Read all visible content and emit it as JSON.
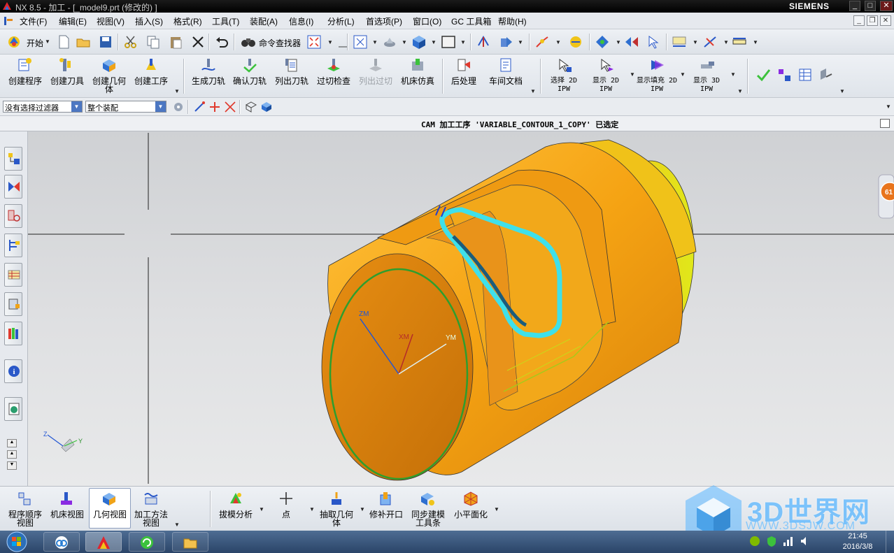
{
  "window": {
    "title": "NX 8.5 - 加工 - [_model9.prt  (修改的) ]",
    "brand": "SIEMENS",
    "buttons": [
      "_",
      "□",
      "✕"
    ]
  },
  "menu": {
    "items": [
      "文件(F)",
      "编辑(E)",
      "视图(V)",
      "插入(S)",
      "格式(R)",
      "工具(T)",
      "装配(A)",
      "信息(I)",
      "分析(L)",
      "首选项(P)",
      "窗口(O)",
      "GC 工具箱",
      "帮助(H)"
    ]
  },
  "toolbar_standard": {
    "start_label": "开始",
    "command_finder_label": "命令查找器"
  },
  "toolbar_operations": {
    "buttons": [
      "创建程序",
      "创建刀具",
      "创建几何体",
      "创建工序",
      "生成刀轨",
      "确认刀轨",
      "列出刀轨",
      "过切检查",
      "列出过切",
      "机床仿真",
      "后处理",
      "车间文档",
      "选择 2D IPW",
      "显示 2D IPW",
      "显示填充 2D IPW",
      "显示 3D IPW"
    ]
  },
  "selection_bar": {
    "filter_value": "没有选择过滤器",
    "scope_value": "整个装配"
  },
  "status": {
    "message": "CAM 加工工序 'VARIABLE_CONTOUR_1_COPY' 已选定"
  },
  "viewport": {
    "axis_labels": {
      "zm": "ZM",
      "xm": "XM",
      "ym": "YM",
      "triad_z": "Z",
      "triad_y": "Y"
    },
    "badge": "61",
    "colors": {
      "part": "#f0a318",
      "toolpath": "#3fe0ea",
      "toolpath_dark": "#1b5c7c",
      "csys": "#2e9e2e"
    }
  },
  "bottom_toolbar": {
    "views": [
      "程序顺序视图",
      "机床视图",
      "几何视图",
      "加工方法视图"
    ],
    "active_view": "几何视图",
    "tools": [
      "拔模分析",
      "点",
      "抽取几何体",
      "修补开口",
      "同步建模工具条",
      "小平面化"
    ]
  },
  "watermark": {
    "text": "3D世界网",
    "url": "WWW.3DSJW.COM"
  },
  "taskbar": {
    "time": "21:45",
    "date": "2016/3/8"
  }
}
